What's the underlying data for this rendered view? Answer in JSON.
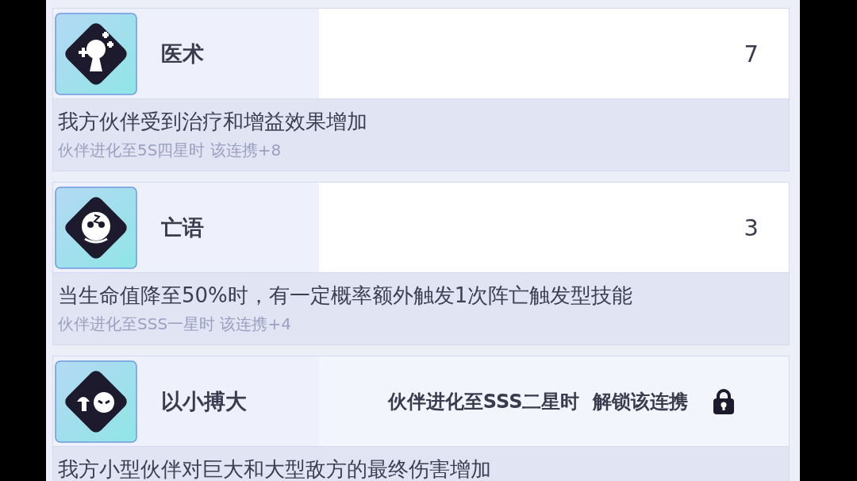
{
  "cards": [
    {
      "name": "医术",
      "locked": false,
      "value": "7",
      "description": "我方伙伴受到治疗和增益效果增加",
      "condition": "伙伴进化至5S四星时 该连携+8"
    },
    {
      "name": "亡语",
      "locked": false,
      "value": "3",
      "description": "当生命值降至50%时，有一定概率额外触发1次阵亡触发型技能",
      "condition": "伙伴进化至SSS一星时 该连携+4"
    },
    {
      "name": "以小搏大",
      "locked": true,
      "lock_text": "伙伴进化至SSS二星时  解锁该连携",
      "description": "我方小型伙伴对巨大和大型敌方的最终伤害增加"
    }
  ]
}
